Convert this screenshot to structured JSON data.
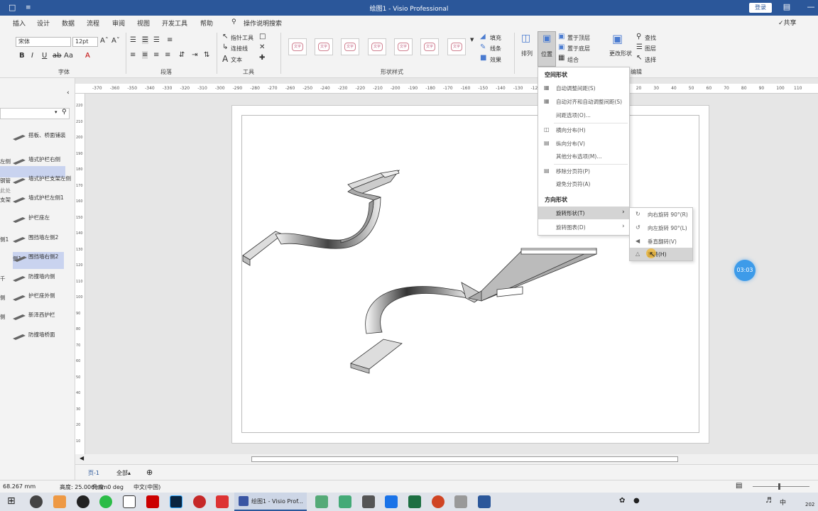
{
  "window": {
    "title": "绘图1  -  Visio Professional",
    "login": "登录"
  },
  "menu": {
    "items": [
      "插入",
      "设计",
      "数据",
      "流程",
      "审阅",
      "视图",
      "开发工具",
      "帮助"
    ],
    "search": "操作说明搜索",
    "share": "共享"
  },
  "ribbon": {
    "font_name": "宋体",
    "font_size": "12pt",
    "group_font": "字体",
    "group_paragraph": "段落",
    "group_tools": "工具",
    "group_shape_styles": "形状样式",
    "group_edit": "编辑",
    "pointer_tool": "指针工具",
    "connector": "连接线",
    "text": "文本",
    "style_sample": "文字",
    "fill": "填充",
    "line": "线条",
    "effects": "效果",
    "arrange": "排列",
    "position": "位置",
    "bring_front": "置于顶层",
    "send_back": "置于底层",
    "group": "组合",
    "change_shape": "更改形状",
    "find": "查找",
    "layers": "图层",
    "select": "选择"
  },
  "ruler": {
    "h_ticks": [
      "-370",
      "-360",
      "-350",
      "-340",
      "-330",
      "-320",
      "-310",
      "-300",
      "-290",
      "-280",
      "-270",
      "-260",
      "-250",
      "-240",
      "-230",
      "-220",
      "-210",
      "-200",
      "-190",
      "-180",
      "-170",
      "-160",
      "-150",
      "-140",
      "-130",
      "-120",
      "-110",
      "-100",
      "-90",
      "0",
      "10",
      "20",
      "30",
      "40",
      "50",
      "60",
      "70",
      "80",
      "90",
      "100",
      "110"
    ],
    "v_ticks": [
      "220",
      "210",
      "200",
      "190",
      "180",
      "170",
      "160",
      "150",
      "140",
      "130",
      "120",
      "110",
      "100",
      "90",
      "80",
      "70",
      "60",
      "50",
      "40",
      "30",
      "20",
      "10"
    ]
  },
  "shapes_panel": {
    "drop_hint": "此处",
    "items": [
      {
        "cut": "",
        "label": "搭板、桥面铺装"
      },
      {
        "cut": "左侧",
        "label": "墙式护栏右侧"
      },
      {
        "cut": "钢管",
        "label": "墙式护栏支架左侧"
      },
      {
        "cut": "支架",
        "label": "墙式护栏左侧1"
      },
      {
        "cut": "",
        "label": "护栏座左"
      },
      {
        "cut": "侧1",
        "label": "围挡墙左侧2"
      },
      {
        "cut": "侧1",
        "label": "围挡墙右侧2"
      },
      {
        "cut": "千",
        "label": "防撞墙内侧"
      },
      {
        "cut": "侧",
        "label": "护栏座外侧"
      },
      {
        "cut": "侧",
        "label": "新泽西护栏"
      },
      {
        "cut": "",
        "label": "防撞墙桥面"
      }
    ]
  },
  "position_menu": {
    "section_space": "空间形状",
    "auto_space": "自动调整间距(S)",
    "auto_align_space": "自动对齐和自动调整间距(S)",
    "spacing_options": "间距选项(O)...",
    "dist_horizontal": "横向分布(H)",
    "dist_vertical": "纵向分布(V)",
    "more_dist": "其他分布选项(M)...",
    "remove_breaks": "移除分页符(P)",
    "avoid_breaks": "避免分页符(A)",
    "section_orient": "方向形状",
    "rotate_shapes": "旋转形状(T)",
    "rotate_diagram": "旋转图表(D)"
  },
  "rotate_submenu": {
    "rotate_right": "向右旋转 90°(R)",
    "rotate_left": "向左旋转 90°(L)",
    "flip_vertical": "垂直翻转(V)",
    "flip_horizontal": "翻转(H)"
  },
  "timer": "03:03",
  "tabs": {
    "page": "页-1",
    "all": "全部"
  },
  "status": {
    "width": "68.267 mm",
    "height": "高度: 25.006 mm",
    "angle": "角度: 0 deg",
    "language": "中文(中国)"
  },
  "taskbar": {
    "visio_label": "绘图1 - Visio Prof...",
    "ime": "中",
    "date": "202"
  }
}
